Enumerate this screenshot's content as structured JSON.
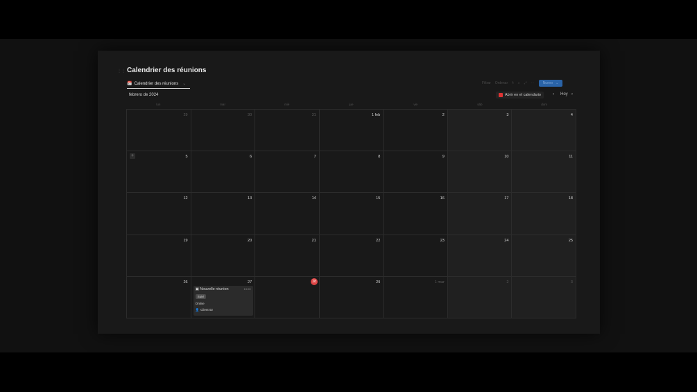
{
  "page": {
    "title": "Calendrier des réunions",
    "tab_label": "Calendrier des réunions",
    "month_label": "febrero de 2024",
    "open_calendar_label": "Abrir en el calendario",
    "today_label": "Hoy",
    "new_button_label": "Nuevo",
    "toolbar": [
      "Filtrar",
      "Ordenar"
    ]
  },
  "weekdays": [
    "lun",
    "mar",
    "mié",
    "jue",
    "vie",
    "sáb",
    "dom"
  ],
  "weeks": [
    [
      {
        "d": "29",
        "o": true
      },
      {
        "d": "30",
        "o": true
      },
      {
        "d": "31",
        "o": true
      },
      {
        "d": "1 feb"
      },
      {
        "d": "2"
      },
      {
        "d": "3"
      },
      {
        "d": "4"
      }
    ],
    [
      {
        "d": "5"
      },
      {
        "d": "6"
      },
      {
        "d": "7"
      },
      {
        "d": "8"
      },
      {
        "d": "9"
      },
      {
        "d": "10"
      },
      {
        "d": "11"
      }
    ],
    [
      {
        "d": "12"
      },
      {
        "d": "13"
      },
      {
        "d": "14"
      },
      {
        "d": "15"
      },
      {
        "d": "16"
      },
      {
        "d": "17"
      },
      {
        "d": "18"
      }
    ],
    [
      {
        "d": "19"
      },
      {
        "d": "20"
      },
      {
        "d": "21"
      },
      {
        "d": "22"
      },
      {
        "d": "23"
      },
      {
        "d": "24"
      },
      {
        "d": "25"
      }
    ],
    [
      {
        "d": "26"
      },
      {
        "d": "27"
      },
      {
        "d": "28",
        "today": true
      },
      {
        "d": "29"
      },
      {
        "d": "1 mar",
        "o": true
      },
      {
        "d": "2",
        "o": true
      },
      {
        "d": "3",
        "o": true
      }
    ]
  ],
  "event": {
    "title": "Nouvelle réunion",
    "time": "13:00",
    "status": "Suivi",
    "location": "Online",
    "client": "Client 02"
  },
  "colors": {
    "today": "#dd4444",
    "accent": "#2a64a8"
  }
}
